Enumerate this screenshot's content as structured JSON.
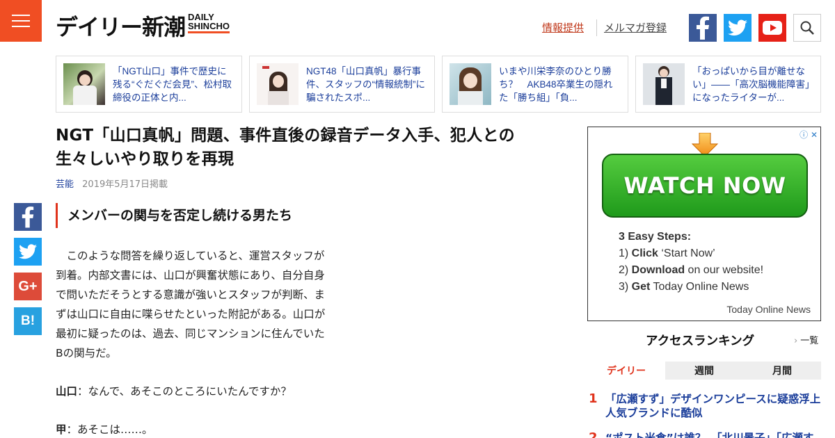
{
  "header": {
    "logo_jp": "デイリー新潮",
    "logo_en_line1": "DAILY",
    "logo_en_line2": "SHINCHO",
    "link_info": "情報提供",
    "link_magazine": "メルマガ登録"
  },
  "related": [
    {
      "title": "「NGT山口」事件で歴史に残る“ぐだぐだ会見”、松村取締役の正体と内..."
    },
    {
      "title": "NGT48「山口真帆」暴行事件、スタッフの“情報統制”に騙されたスポ..."
    },
    {
      "title": "いまや川栄李奈のひとり勝ち？　AKB48卒業生の隠れた「勝ち組」「負..."
    },
    {
      "title": "「おっぱいから目が離せない」――「高次脳機能障害」になったライターが..."
    }
  ],
  "article": {
    "title": "NGT「山口真帆」問題、事件直後の録音データ入手、犯人との生々しいやり取りを再現",
    "category": "芸能",
    "date": "2019年5月17日掲載",
    "subheading": "メンバーの関与を否定し続ける男たち",
    "paragraph": "このような問答を繰り返していると、運営スタッフが到着。内部文書には、山口が興奮状態にあり、自分自身で問いただそうとする意識が強いとスタッフが判断、まずは山口に自由に喋らせたといった附記がある。山口が最初に疑ったのは、過去、同じマンションに住んでいたBの関与だ。",
    "dialog": [
      {
        "speaker": "山口",
        "text": "：なんで、あそこのところにいたんですか？"
      },
      {
        "speaker": "甲",
        "text": "：あそこは……。"
      }
    ]
  },
  "ad": {
    "adchoices": "ⓘ ✕",
    "button": "WATCH NOW",
    "steps_title": "3 Easy Steps:",
    "step1_bold": "Click",
    "step1_rest": " ‘Start Now’",
    "step2_bold": "Download",
    "step2_rest": " on our website!",
    "step3_bold": "Get",
    "step3_rest": " Today Online News",
    "brand": "Today Online News"
  },
  "ranking": {
    "title": "アクセスランキング",
    "more": "一覧",
    "tabs": [
      "デイリー",
      "週間",
      "月間"
    ],
    "items": [
      {
        "num": "1",
        "text": "「広瀬すず」デザインワンピースに疑惑浮上　人気ブランドに酷似"
      },
      {
        "num": "2",
        "text": "“ポスト米倉”は誰？　「北川景子」「広瀬すず」"
      }
    ]
  },
  "colors": {
    "accent": "#f04e23",
    "link": "#1a3d9a",
    "facebook": "#3b5998",
    "twitter": "#1da1f2",
    "youtube": "#e62117",
    "hatena": "#28a1e0",
    "googleplus": "#dd4b39"
  }
}
